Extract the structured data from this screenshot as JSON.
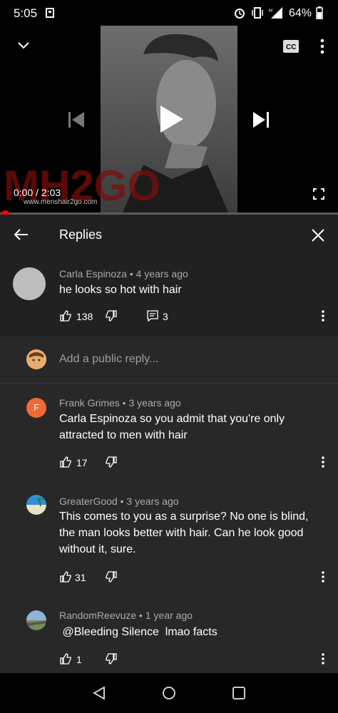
{
  "status": {
    "time": "5:05",
    "battery": "64%"
  },
  "video": {
    "time_current": "0:00",
    "time_separator": " / ",
    "time_total": "2:03"
  },
  "header": {
    "title": "Replies"
  },
  "top_comment": {
    "author": "Carla Espinoza",
    "age": "4 years ago",
    "text": "he looks so hot with hair",
    "likes": "138",
    "replies": "3"
  },
  "reply_box": {
    "placeholder": "Add a public reply..."
  },
  "replies": [
    {
      "avatar_letter": "F",
      "author": "Frank Grimes",
      "age": "3 years ago",
      "text": "Carla Espinoza so you admit that you're only attracted to men with hair",
      "likes": "17"
    },
    {
      "author": "GreaterGood",
      "age": "3 years ago",
      "text": "This comes to you as a surprise? No one is blind, the man looks better with hair. Can he look good without it, sure.",
      "likes": "31"
    },
    {
      "author": "RandomReevuze",
      "age": "1 year ago",
      "text": " @Bleeding Silence  lmao facts",
      "likes": "1"
    }
  ],
  "sep": " • ",
  "colors": {
    "accent": "#ff0000",
    "background": "#282828",
    "orange_avatar": "#f06a33"
  }
}
